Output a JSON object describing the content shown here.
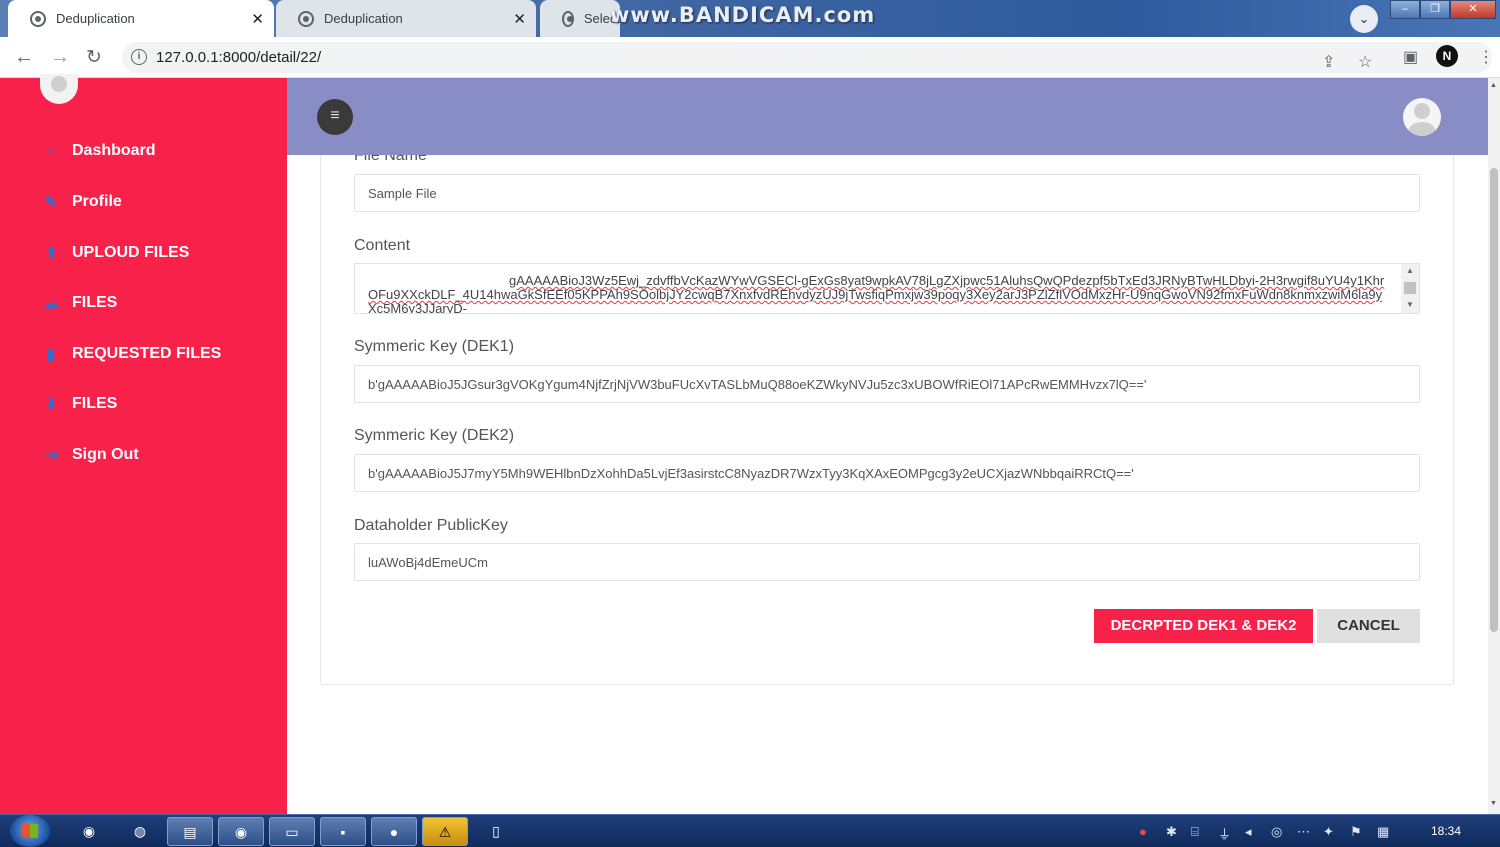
{
  "browser": {
    "tabs": [
      {
        "title": "Deduplication",
        "active": true
      },
      {
        "title": "Deduplication",
        "active": false
      },
      {
        "title": "Select",
        "active": false
      }
    ],
    "watermark": "www.BANDICAM.com",
    "url": "127.0.0.1:8000/detail/22/"
  },
  "sidebar": {
    "items": [
      {
        "label": "Dashboard",
        "icon": "home-icon"
      },
      {
        "label": "Profile",
        "icon": "pencil-icon"
      },
      {
        "label": "UPLOUD FILES",
        "icon": "upload-icon"
      },
      {
        "label": "FILES",
        "icon": "cloud-icon"
      },
      {
        "label": "REQUESTED FILES",
        "icon": "file-icon"
      },
      {
        "label": "FILES",
        "icon": "download-icon"
      },
      {
        "label": "Sign Out",
        "icon": "sign-out-icon"
      }
    ]
  },
  "form": {
    "file_name_label": "File Name",
    "file_name_value": "Sample File",
    "content_label": "Content",
    "content_value": "gAAAAABioJ3Wz5Ewj_zdvffbVcKazWYwVGSECl-gExGs8yat9wpkAV78jLgZXjpwc51AluhsQwQPdezpf5bTxEd3JRNyBTwHLDbyi-2H3rwgif8uYU4y1KhrOFu9XXckDLF_4U14hwaGkSfEEf05KPPAh9SOolbjJY2cwqB7XnxfvdREhvdyzUJ9jTwsfiqPmxjw39poqy3Xey2arJ3PZlZflVOdMxzHr-U9nqGwoVN92fmxFuWdn8knmxzwiM6la9yXc5M6y3JJaryD-",
    "dek1_label": "Symmeric Key (DEK1)",
    "dek1_value": "b'gAAAAABioJ5JGsur3gVOKgYgum4NjfZrjNjVW3buFUcXvTASLbMuQ88oeKZWkyNVJu5zc3xUBOWfRiEOl71APcRwEMMHvzx7lQ=='",
    "dek2_label": "Symmeric Key (DEK2)",
    "dek2_value": "b'gAAAAABioJ5J7myY5Mh9WEHlbnDzXohhDa5LvjEf3asirstcC8NyazDR7WzxTyy3KqXAxEOMPgcg3y2eUCXjazWNbbqaiRRCtQ=='",
    "publickey_label": "Dataholder PublicKey",
    "publickey_value": "luAWoBj4dEmeUCm",
    "decrypt_button": "DECRPTED DEK1 & DEK2",
    "cancel_button": "CANCEL"
  },
  "taskbar": {
    "clock": "18:34"
  },
  "colors": {
    "sidebar": "#f7214a",
    "topbar": "#888dc6",
    "primary_button": "#f7214a"
  }
}
